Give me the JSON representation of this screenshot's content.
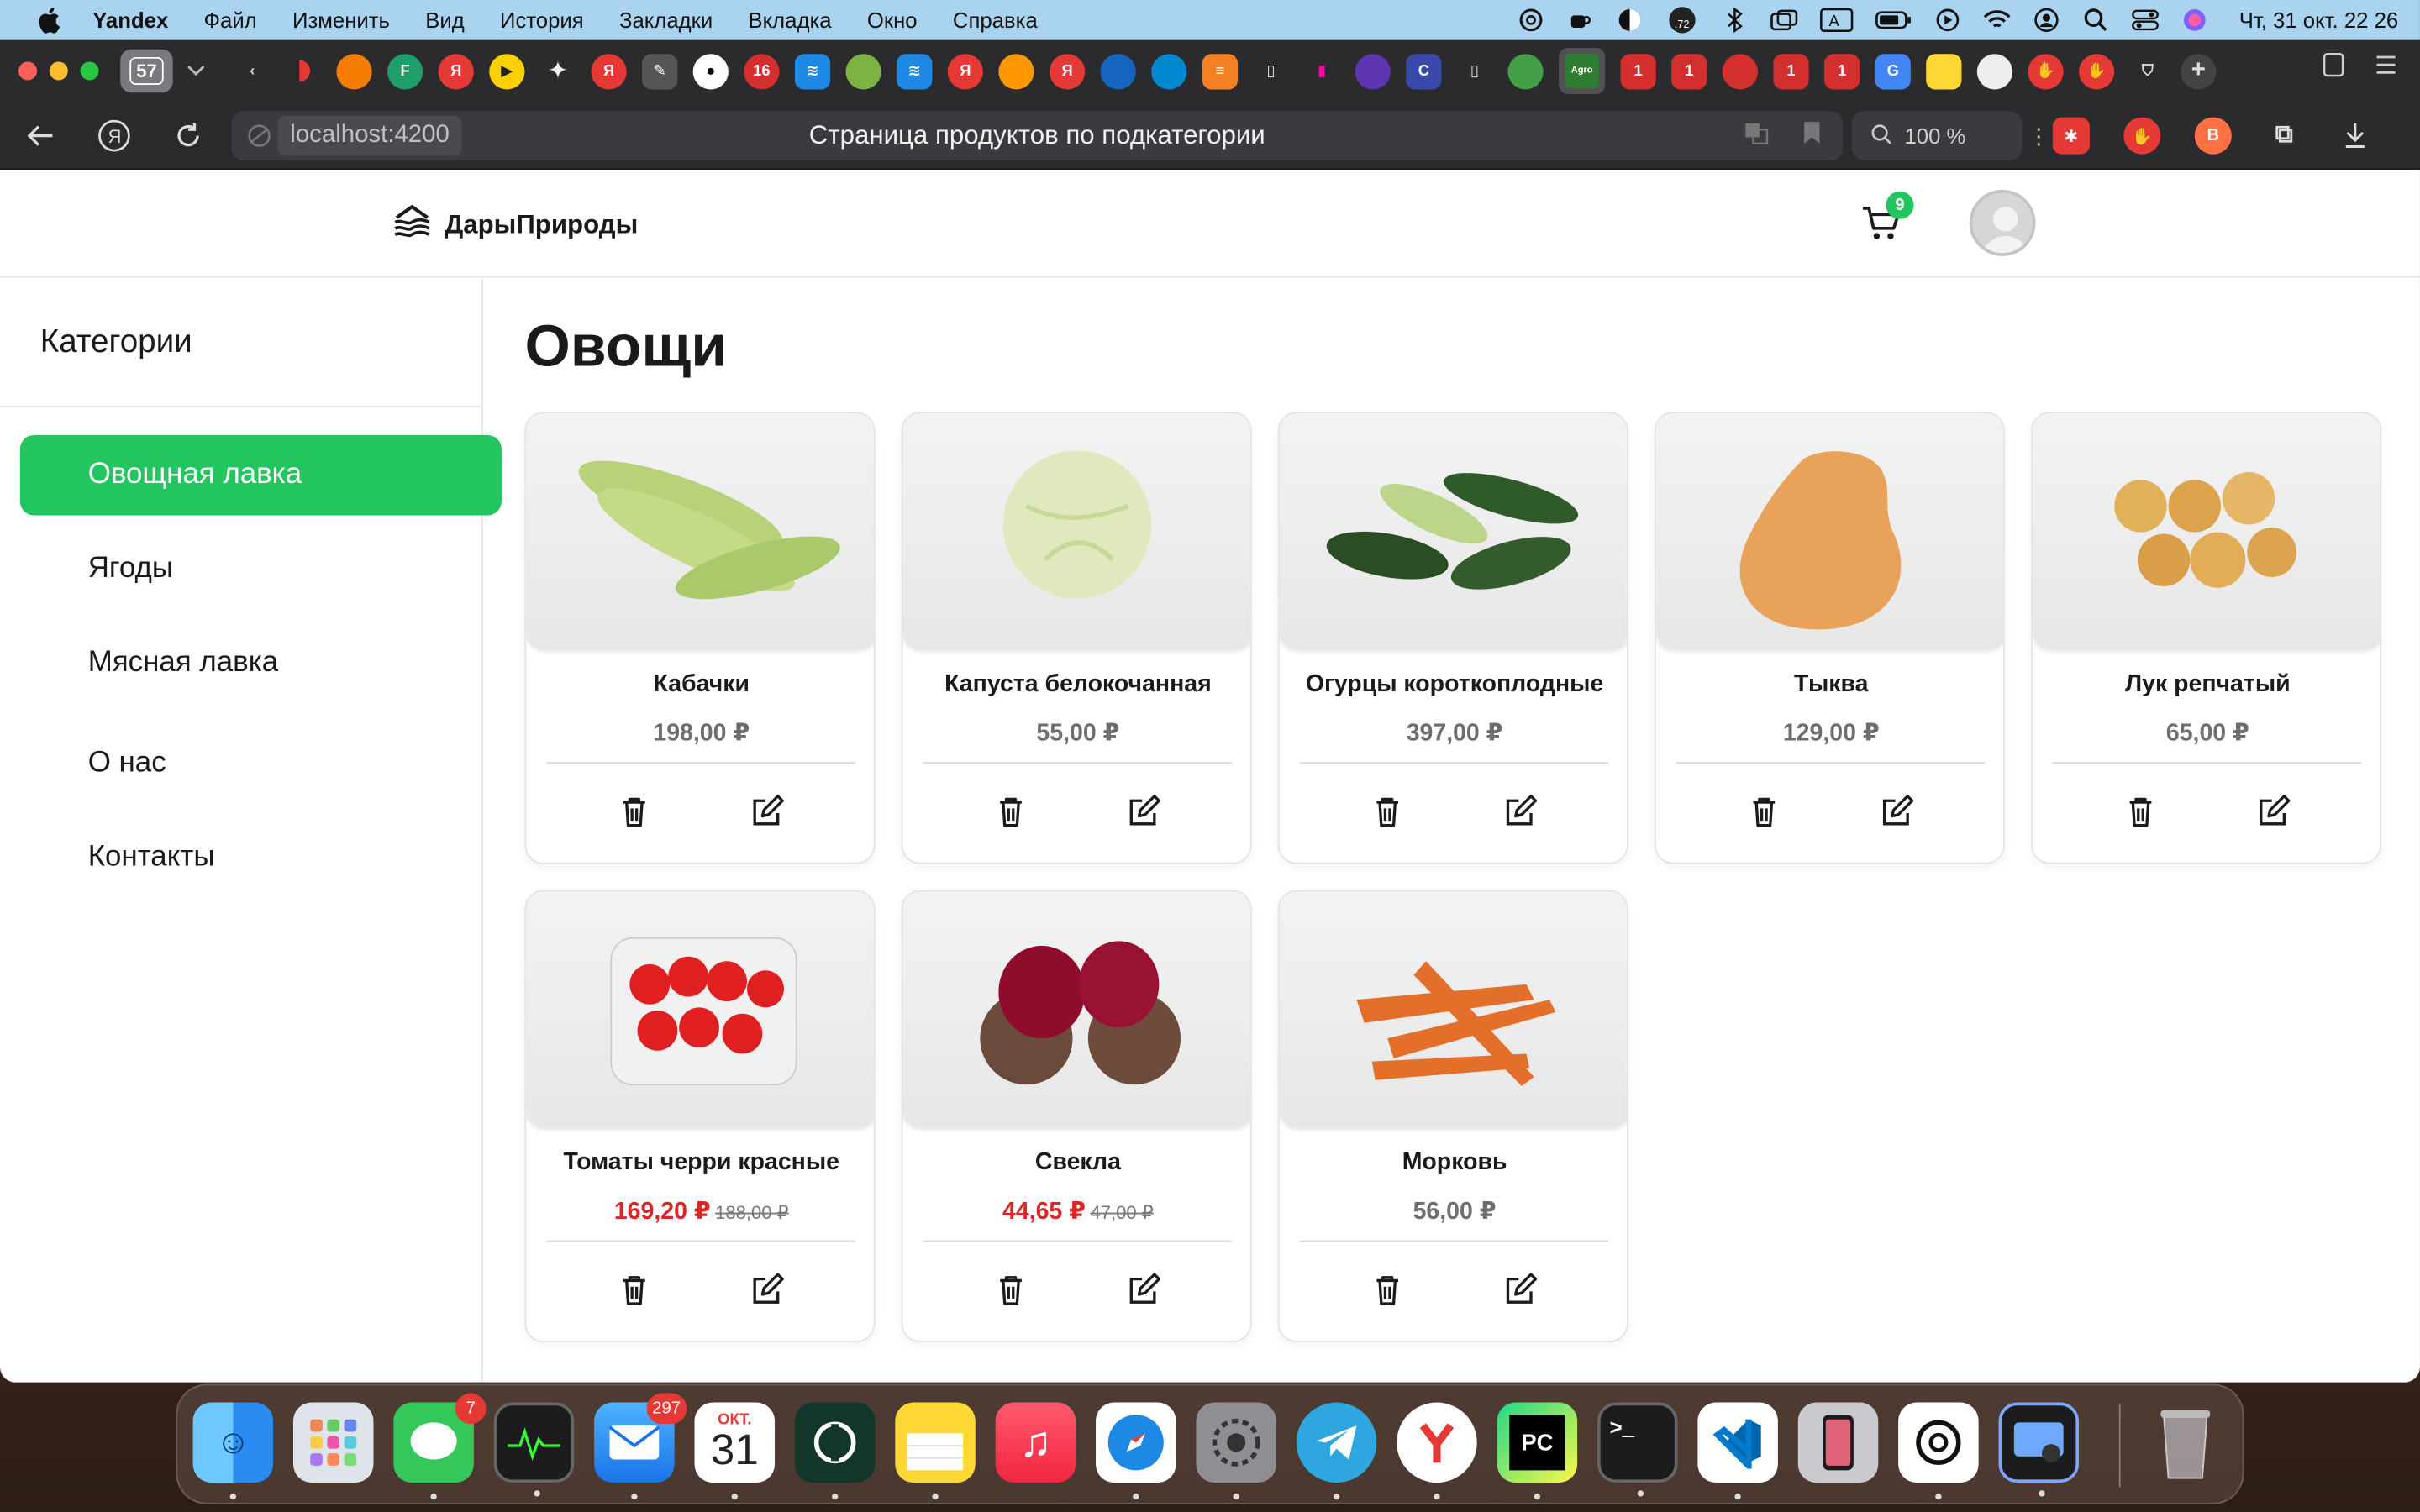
{
  "menubar": {
    "app_name": "Yandex",
    "items": [
      "Файл",
      "Изменить",
      "Вид",
      "История",
      "Закладки",
      "Вкладка",
      "Окно",
      "Справка"
    ],
    "clock": "Чт, 31 окт.  22 26",
    "status_badge": ".72"
  },
  "browser": {
    "tab_count": "57",
    "url_host": "localhost:4200",
    "page_title": "Страница продуктов по подкатегории",
    "zoom_level": "100 %"
  },
  "header": {
    "logo_text": "ДарыПрироды",
    "cart_count": "9"
  },
  "sidebar": {
    "title": "Категории",
    "items": [
      {
        "label": "Овощная лавка",
        "active": true
      },
      {
        "label": "Ягоды",
        "active": false
      },
      {
        "label": "Мясная лавка",
        "active": false
      },
      {
        "label": "О нас",
        "active": false
      },
      {
        "label": "Контакты",
        "active": false
      }
    ]
  },
  "main": {
    "title": "Овощи",
    "products": [
      {
        "name": "Кабачки",
        "price": "198,00 ₽",
        "old_price": "",
        "image": "zucchini"
      },
      {
        "name": "Капуста белокочанная",
        "price": "55,00 ₽",
        "old_price": "",
        "image": "cabbage"
      },
      {
        "name": "Огурцы короткоплодные",
        "price": "397,00 ₽",
        "old_price": "",
        "image": "cucumbers"
      },
      {
        "name": "Тыква",
        "price": "129,00 ₽",
        "old_price": "",
        "image": "pumpkin"
      },
      {
        "name": "Лук репчатый",
        "price": "65,00 ₽",
        "old_price": "",
        "image": "onions"
      },
      {
        "name": "Томаты черри красные",
        "price": "169,20 ₽",
        "old_price": "188,00 ₽",
        "image": "cherry-tomatoes"
      },
      {
        "name": "Свекла",
        "price": "44,65 ₽",
        "old_price": "47,00 ₽",
        "image": "beetroot"
      },
      {
        "name": "Морковь",
        "price": "56,00 ₽",
        "old_price": "",
        "image": "carrots"
      }
    ]
  },
  "dock": {
    "messages_badge": "7",
    "mail_badge": "297",
    "calendar_month": "ОКТ.",
    "calendar_day": "31",
    "pycharm_label": "PC",
    "terminal_label": ">_"
  },
  "colors": {
    "accent": "#22c55e",
    "sale": "#dc2626"
  }
}
